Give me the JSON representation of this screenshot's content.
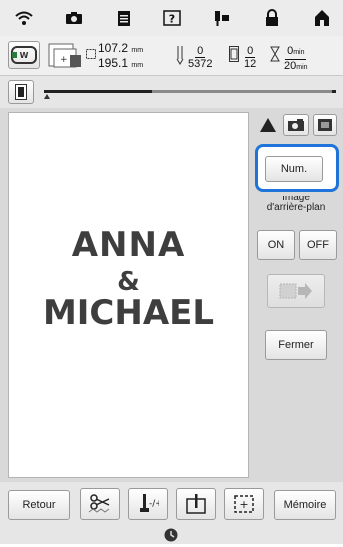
{
  "status_bar": {
    "icons": [
      "wifi-icon",
      "camera-icon",
      "document-icon",
      "help-icon",
      "needle-icon",
      "lock-icon",
      "home-icon"
    ]
  },
  "info_bar": {
    "width": "107.2",
    "height": "195.1",
    "unit": "mm",
    "stitch_current": "0",
    "stitch_total": "5372",
    "color_current": "0",
    "color_total": "12",
    "time_current": "0",
    "time_total": "20",
    "time_unit": "min"
  },
  "canvas": {
    "line1": "ANNA",
    "line2": "&",
    "line3": "MICHAEL"
  },
  "panel": {
    "num_label": "Num.",
    "bg_label_line1": "Image",
    "bg_label_line2": "d'arrière-plan",
    "on_label": "ON",
    "off_label": "OFF",
    "close_label": "Fermer"
  },
  "footer": {
    "back_label": "Retour",
    "memory_label": "Mémoire"
  },
  "colors": {
    "highlight": "#1e74d9",
    "text_dark": "#3e3e3e"
  }
}
